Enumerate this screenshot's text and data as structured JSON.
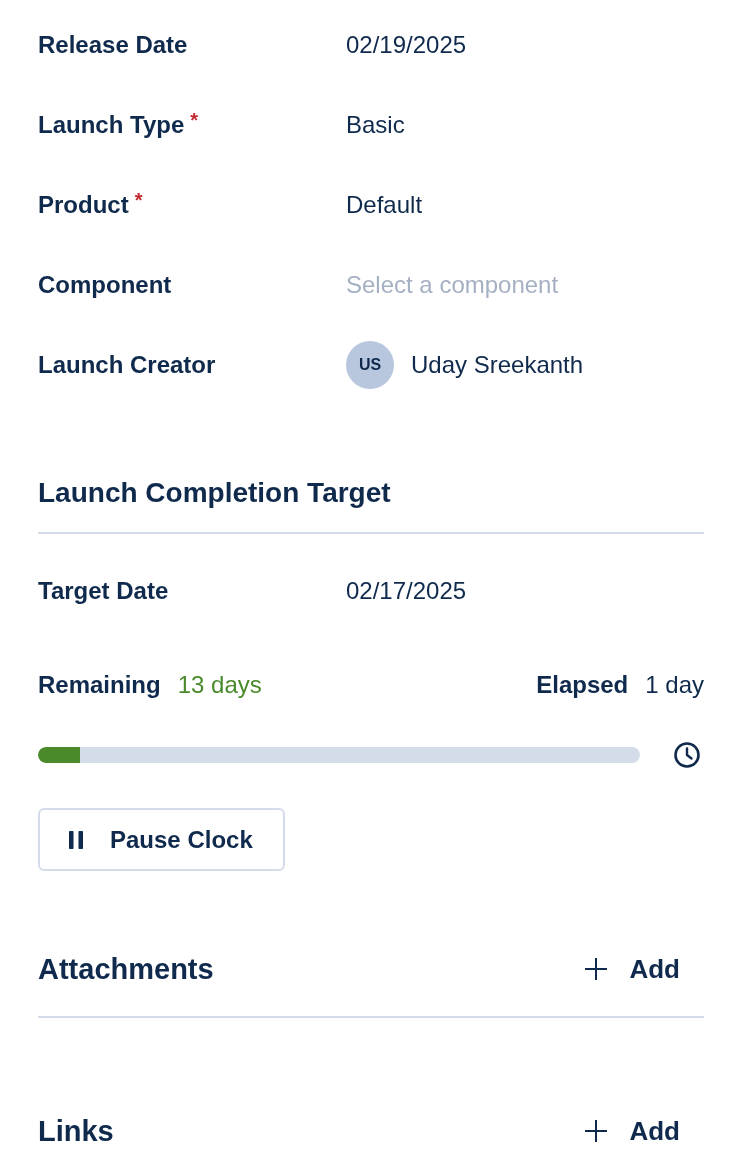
{
  "fields": [
    {
      "kind": "text",
      "label": "Release Date",
      "value": "02/19/2025"
    },
    {
      "kind": "text",
      "label": "Launch Type",
      "required_mark": "*",
      "value": "Basic"
    },
    {
      "kind": "text",
      "label": "Product",
      "required_mark": "*",
      "value": "Default"
    },
    {
      "kind": "select",
      "label": "Component",
      "placeholder": "Select a component"
    },
    {
      "kind": "user",
      "label": "Launch Creator",
      "avatar_initials": "US",
      "value": "Uday Sreekanth"
    }
  ],
  "target": {
    "title": "Launch Completion Target",
    "date_label": "Target Date",
    "date": "02/17/2025",
    "remaining_label": "Remaining",
    "remaining": "13 days",
    "elapsed_label": "Elapsed",
    "elapsed": "1 day",
    "progress": {
      "level": 0.07
    },
    "pause_button": "Pause Clock"
  },
  "sections": [
    {
      "title": "Attachments",
      "action": "Add"
    },
    {
      "title": "Links",
      "action": "Add"
    }
  ]
}
